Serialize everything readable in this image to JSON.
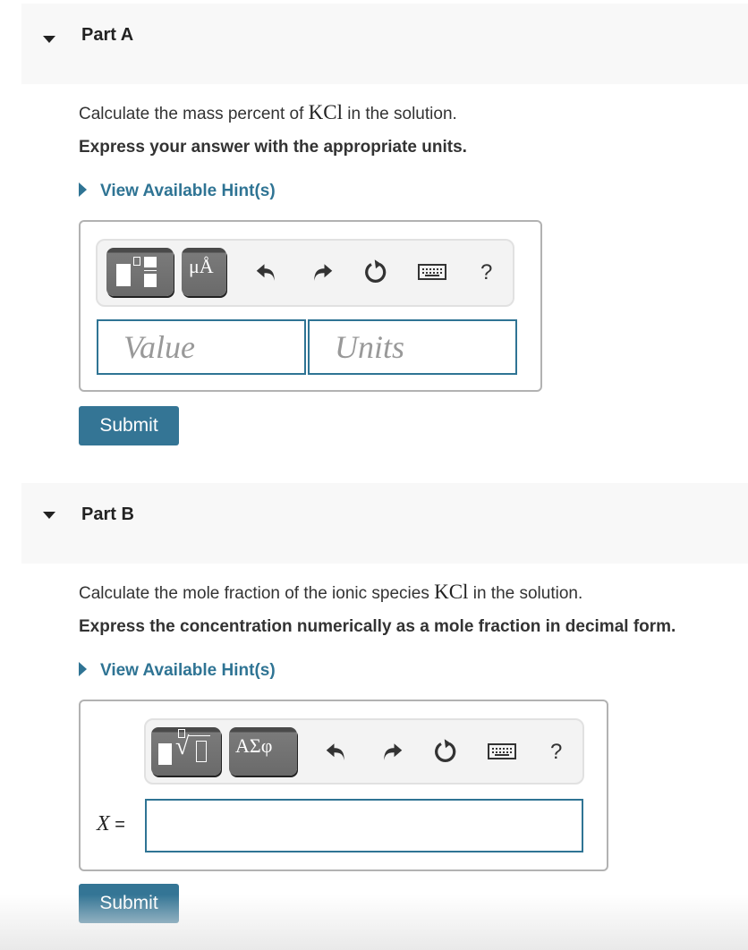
{
  "parts": [
    {
      "title": "Part A",
      "question_prefix": "Calculate the mass percent of ",
      "question_math": "KCl",
      "question_suffix": " in the solution.",
      "instruction": "Express your answer with the appropriate units.",
      "hint_label": "View Available Hint(s)",
      "toolbar": {
        "buttons": [
          "templates-button",
          "symbols-button"
        ],
        "symbols_label": "μÅ",
        "icons": [
          "undo-icon",
          "redo-icon",
          "reset-icon",
          "keyboard-icon",
          "help-icon"
        ],
        "help_label": "?"
      },
      "value_placeholder": "Value",
      "units_placeholder": "Units",
      "submit_label": "Submit"
    },
    {
      "title": "Part B",
      "question_prefix": "Calculate the mole fraction of the ionic species ",
      "question_math": "KCl",
      "question_suffix": " in the solution.",
      "instruction": "Express the concentration numerically as a mole fraction in decimal form.",
      "hint_label": "View Available Hint(s)",
      "toolbar": {
        "buttons": [
          "templates-button",
          "greek-symbols-button"
        ],
        "symbols_label": "ΑΣφ",
        "icons": [
          "undo-icon",
          "redo-icon",
          "reset-icon",
          "keyboard-icon",
          "help-icon"
        ],
        "help_label": "?"
      },
      "input_label_var": "X",
      "input_label_eq": "=",
      "input_value": "",
      "submit_label": "Submit"
    }
  ],
  "colors": {
    "accent": "#2f7494",
    "submit_bg": "#347595",
    "header_bg": "#f8f8f8"
  }
}
